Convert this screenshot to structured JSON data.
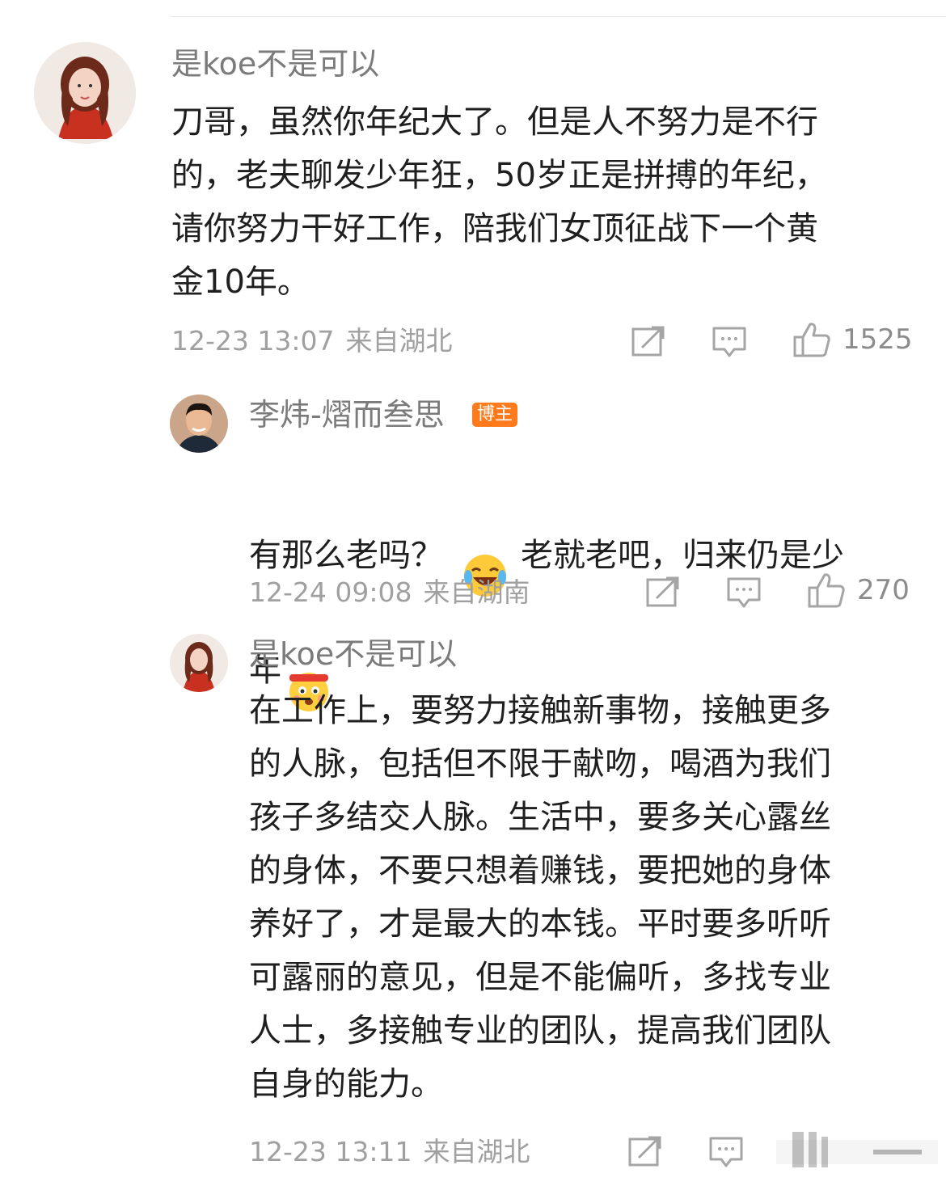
{
  "comments": [
    {
      "username": "是koe不是可以",
      "text": "刀哥，虽然你年纪大了。但是人不努力是不行\n的，老夫聊发少年狂，50岁正是拼搏的年纪，\n请你努力干好工作，陪我们女顶征战下一个黄\n金10年。",
      "time": "12-23 13:07",
      "location": "来自湖北",
      "likes": "1525"
    },
    {
      "username": "李炜-熠而叁思",
      "badge": "博主",
      "text_part1": "有那么老吗？",
      "text_part2": "老就老吧，归来仍是少",
      "text_part3": "年",
      "emoji1": "laugh-cry-emoji",
      "emoji2": "headband-face-emoji",
      "time": "12-24 09:08",
      "location": "来自湖南",
      "likes": "270"
    },
    {
      "username": "是koe不是可以",
      "text": "在工作上，要努力接触新事物，接触更多\n的人脉，包括但不限于献吻，喝酒为我们\n孩子多结交人脉。生活中，要多关心露丝\n的身体，不要只想着赚钱，要把她的身体\n养好了，才是最大的本钱。平时要多听听\n可露丽的意见，但是不能偏听，多找专业\n人士，多接触专业的团队，提高我们团队\n自身的能力。",
      "time": "12-23 13:11",
      "location": "来自湖北"
    }
  ],
  "icons": {
    "repost": "repost-icon",
    "comment": "comment-icon",
    "like": "thumbs-up-icon"
  },
  "colors": {
    "badge": "#ff7a1a",
    "meta": "#a0a0a0",
    "username": "#7b7b7b"
  }
}
